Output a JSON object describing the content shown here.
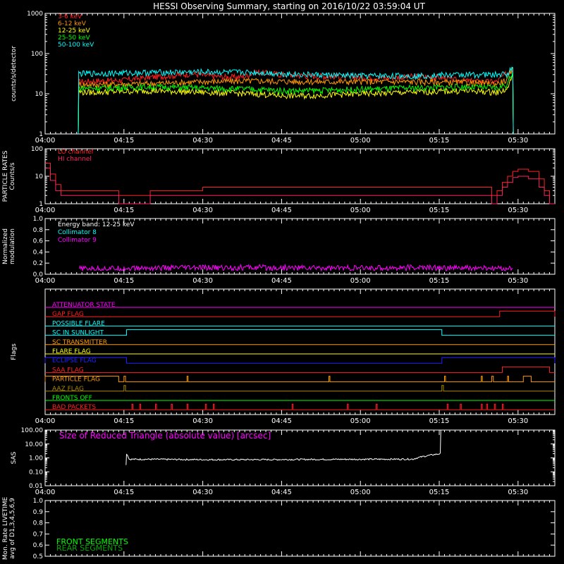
{
  "title": "HESSI Observing Summary, starting on 2016/10/22 03:59:04 UT",
  "time_ticks": [
    "04:00",
    "04:15",
    "04:30",
    "04:45",
    "05:00",
    "05:15",
    "05:30"
  ],
  "chart_data": [
    {
      "type": "line",
      "panel": "count_rates",
      "ylabel": "counts/s/detector",
      "yscale": "log",
      "ylim": [
        1,
        1000
      ],
      "ytick_labels": [
        "1",
        "10",
        "100",
        "1000"
      ],
      "grid": false,
      "legend_position": "top-left",
      "x_unit": "minutes after 04:00 UT",
      "x_range": [
        0,
        40
      ],
      "series": [
        {
          "name": "3-6 keV",
          "color": "#ff2020",
          "x": [
            6.3,
            6.4,
            10,
            15,
            20,
            25,
            28,
            30,
            33,
            36,
            38,
            40,
            45,
            50,
            55,
            60,
            65,
            70,
            75,
            78,
            80,
            83,
            86,
            89,
            89.1
          ],
          "y": [
            1,
            20,
            21,
            22,
            26,
            29,
            32,
            29,
            27,
            26,
            27,
            35,
            30,
            28,
            27,
            26,
            25,
            27,
            26,
            22,
            21,
            20,
            20,
            40,
            1
          ]
        },
        {
          "name": "6-12 keV",
          "color": "#ff9900",
          "x": [
            6.3,
            6.4,
            10,
            20,
            30,
            40,
            50,
            60,
            70,
            80,
            86,
            88,
            89,
            89.1
          ],
          "y": [
            1,
            17,
            17,
            18,
            20,
            21,
            20,
            20,
            20,
            19,
            18,
            22,
            42,
            1
          ]
        },
        {
          "name": "12-25 keV",
          "color": "#ffff00",
          "x": [
            6.3,
            6.4,
            10,
            20,
            30,
            40,
            45,
            50,
            60,
            70,
            80,
            86,
            88,
            89,
            89.1
          ],
          "y": [
            1,
            11,
            11,
            12,
            11,
            10,
            9,
            9,
            10,
            11,
            12,
            11,
            13,
            30,
            1
          ]
        },
        {
          "name": "25-50 keV",
          "color": "#00ff00",
          "x": [
            6.3,
            6.4,
            10,
            20,
            30,
            40,
            45,
            50,
            60,
            70,
            80,
            86,
            88,
            89,
            89.1
          ],
          "y": [
            1,
            14,
            14,
            15,
            14,
            13,
            12,
            12,
            13,
            14,
            15,
            14,
            17,
            35,
            1
          ]
        },
        {
          "name": "50-100 keV",
          "color": "#00ffff",
          "x": [
            6.3,
            6.4,
            10,
            20,
            30,
            40,
            50,
            60,
            70,
            80,
            86,
            88,
            89,
            89.1
          ],
          "y": [
            1,
            32,
            32,
            34,
            35,
            34,
            30,
            28,
            28,
            30,
            30,
            31,
            45,
            1
          ]
        }
      ]
    },
    {
      "type": "line",
      "panel": "particle_rates",
      "ylabel": "PARTICLE RATES\nCounts/s",
      "yscale": "log",
      "ylim": [
        1,
        100
      ],
      "ytick_labels": [
        "1",
        "10",
        "100"
      ],
      "series": [
        {
          "name": "LO channel",
          "color": "#ff2020",
          "x": [
            0,
            1,
            2,
            3,
            6,
            10,
            14,
            20,
            30,
            40,
            50,
            60,
            70,
            80,
            85,
            86,
            87,
            88,
            89,
            90,
            92,
            94,
            95,
            96,
            97
          ],
          "y": [
            30,
            12,
            5,
            3,
            3,
            3,
            2,
            3,
            4,
            4,
            4,
            4,
            4,
            4,
            2,
            3,
            6,
            10,
            15,
            18,
            15,
            8,
            3,
            1,
            1
          ]
        },
        {
          "name": "HI channel",
          "color": "#ff2060",
          "x": [
            0,
            1,
            2,
            3,
            6,
            10,
            14,
            20,
            30,
            40,
            50,
            60,
            70,
            80,
            85,
            86,
            87,
            88,
            89,
            90,
            92,
            94,
            95,
            96,
            97
          ],
          "y": [
            20,
            7,
            3,
            2,
            2,
            2,
            1,
            2,
            2,
            2,
            2,
            2,
            2,
            2,
            1,
            2,
            4,
            6,
            9,
            10,
            8,
            4,
            2,
            1,
            1
          ]
        }
      ]
    },
    {
      "type": "line",
      "panel": "modulation",
      "ylabel": "Normalized\nmodulation",
      "ylim": [
        0,
        1
      ],
      "ytick_labels": [
        "0.0",
        "0.2",
        "0.4",
        "0.6",
        "0.8",
        "1.0"
      ],
      "annotation": "Energy band: 12-25 keV",
      "series": [
        {
          "name": "Collimator 8",
          "color": "#00ffff",
          "x": [],
          "y": []
        },
        {
          "name": "Collimator 9",
          "color": "#ff00ff",
          "x": [
            6.5,
            20,
            40,
            60,
            70,
            80,
            89
          ],
          "y": [
            0.1,
            0.11,
            0.12,
            0.11,
            0.12,
            0.11,
            0.1
          ]
        }
      ]
    },
    {
      "type": "line",
      "panel": "flags",
      "ylabel": "Flags",
      "flags": [
        {
          "name": "ATTENUATOR STATE",
          "color": "#ff00ff",
          "on": []
        },
        {
          "name": "GAP FLAG",
          "color": "#ff2020",
          "on": [
            [
              86.5,
              97
            ]
          ]
        },
        {
          "name": "POSSIBLE FLARE",
          "color": "#00ffff",
          "on": []
        },
        {
          "name": "SC IN SUNLIGHT",
          "color": "#00ffff",
          "on": [
            [
              15.5,
              75.5
            ]
          ]
        },
        {
          "name": "SC TRANSMITTER",
          "color": "#ff9900",
          "on": []
        },
        {
          "name": "FLARE FLAG",
          "color": "#ffff00",
          "on": []
        },
        {
          "name": "ECLIPSE FLAG",
          "color": "#2020ff",
          "on": [
            [
              0,
              15.5
            ],
            [
              75.5,
              97
            ]
          ]
        },
        {
          "name": "SAA FLAG",
          "color": "#ff2020",
          "on": [
            [
              87,
              96
            ]
          ]
        },
        {
          "name": "PARTICLE FLAG",
          "color": "#ff9900",
          "on": [
            [
              0,
              14
            ],
            [
              15,
              15.3
            ],
            [
              27,
              27.2
            ],
            [
              54,
              54.2
            ],
            [
              76,
              76.2
            ],
            [
              83,
              83.2
            ],
            [
              85,
              85.3
            ],
            [
              88,
              88.2
            ],
            [
              91,
              92.5
            ]
          ]
        },
        {
          "name": "AAZ FLAG",
          "color": "#aa8800",
          "on": [
            [
              15,
              15.3
            ],
            [
              75.5,
              75.8
            ]
          ]
        },
        {
          "name": "FRONTS OFF",
          "color": "#00ff00",
          "on": []
        },
        {
          "name": "BAD PACKETS",
          "color": "#ff2020",
          "on": [
            [
              16.5,
              16.7
            ],
            [
              18,
              18.2
            ],
            [
              21,
              21.2
            ],
            [
              24,
              24.2
            ],
            [
              27,
              27.2
            ],
            [
              30.5,
              30.7
            ],
            [
              32,
              32.2
            ],
            [
              47,
              47.2
            ],
            [
              57.5,
              57.7
            ],
            [
              63,
              63.2
            ],
            [
              76.5,
              76.7
            ],
            [
              79,
              79.2
            ],
            [
              83,
              83.2
            ],
            [
              84,
              84.2
            ],
            [
              85.5,
              85.7
            ],
            [
              87,
              87.2
            ]
          ]
        }
      ]
    },
    {
      "type": "line",
      "panel": "sas",
      "ylabel": "SAS",
      "yscale": "log",
      "ylim": [
        0.01,
        100
      ],
      "ytick_labels": [
        "0.01",
        "0.10",
        "1.00",
        "10.00",
        "100.00"
      ],
      "annotation": "Size of Reduced Triangle (absolute value) [arcsec]",
      "series": [
        {
          "name": "SAS",
          "color": "#ffffff",
          "x": [
            15.4,
            15.5,
            16,
            20,
            30,
            40,
            50,
            60,
            70,
            75.2,
            75.3
          ],
          "y": [
            0.3,
            2,
            0.8,
            0.8,
            0.75,
            0.75,
            0.78,
            0.8,
            0.82,
            2,
            100
          ]
        }
      ]
    },
    {
      "type": "line",
      "panel": "monitor_livetime",
      "ylabel": "Mon. Rate LIVETIME\navg of D1,3,4,5,6,9",
      "ylim": [
        0.5,
        1.0
      ],
      "ytick_labels": [
        "0.5",
        "0.6",
        "0.7",
        "0.8",
        "0.9",
        "1.0"
      ],
      "series": [
        {
          "name": "FRONT SEGMENTS",
          "color": "#00ff00",
          "x": [],
          "y": []
        },
        {
          "name": "REAR SEGMENTS",
          "color": "#00aa00",
          "x": [],
          "y": []
        }
      ]
    }
  ]
}
